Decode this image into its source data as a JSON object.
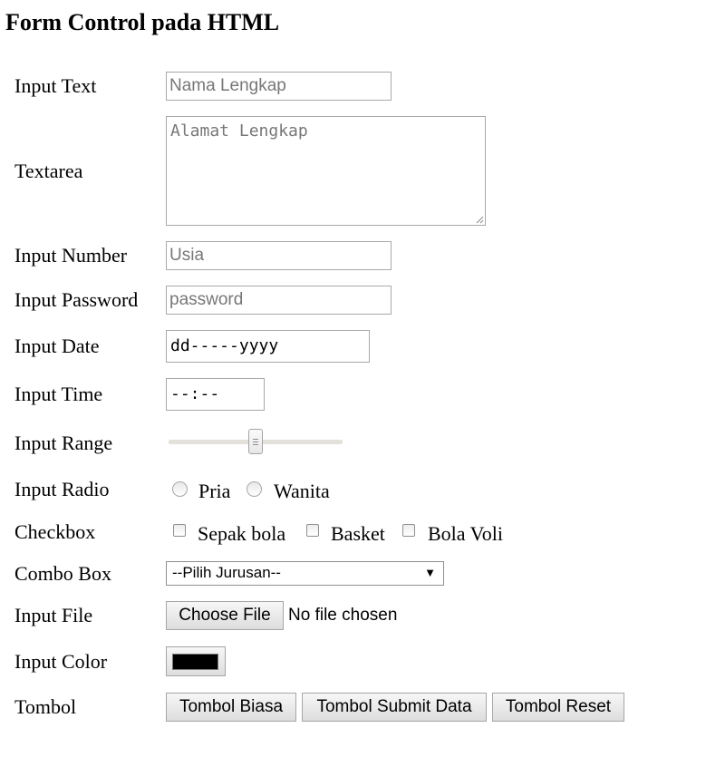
{
  "page": {
    "title": "Form Control pada HTML"
  },
  "labels": {
    "input_text": "Input Text",
    "textarea": "Textarea",
    "input_number": "Input Number",
    "input_password": "Input Password",
    "input_date": "Input Date",
    "input_time": "Input Time",
    "input_range": "Input Range",
    "input_radio": "Input Radio",
    "checkbox": "Checkbox",
    "combo_box": "Combo Box",
    "input_file": "Input File",
    "input_color": "Input Color",
    "tombol": "Tombol"
  },
  "fields": {
    "text": {
      "value": "",
      "placeholder": "Nama Lengkap"
    },
    "textarea": {
      "value": "",
      "placeholder": "Alamat Lengkap"
    },
    "number": {
      "value": "",
      "placeholder": "Usia"
    },
    "password": {
      "value": "",
      "placeholder": "password"
    },
    "date": {
      "display": "dd-----yyyy"
    },
    "time": {
      "display": "--:--"
    },
    "range": {
      "value": 50,
      "min": 0,
      "max": 100
    },
    "radio": {
      "options": [
        {
          "label": "Pria",
          "checked": false
        },
        {
          "label": "Wanita",
          "checked": false
        }
      ]
    },
    "checkbox": {
      "options": [
        {
          "label": "Sepak bola",
          "checked": false
        },
        {
          "label": "Basket",
          "checked": false
        },
        {
          "label": "Bola Voli",
          "checked": false
        }
      ]
    },
    "combo": {
      "selected": "--Pilih Jurusan--"
    },
    "file": {
      "button_label": "Choose File",
      "status": "No file chosen"
    },
    "color": {
      "value": "#000000"
    }
  },
  "buttons": {
    "biasa": "Tombol Biasa",
    "submit": "Tombol Submit Data",
    "reset": "Tombol Reset"
  },
  "icons": {
    "select_arrow": "chevron-down-icon",
    "resize": "resize-grip-icon"
  }
}
